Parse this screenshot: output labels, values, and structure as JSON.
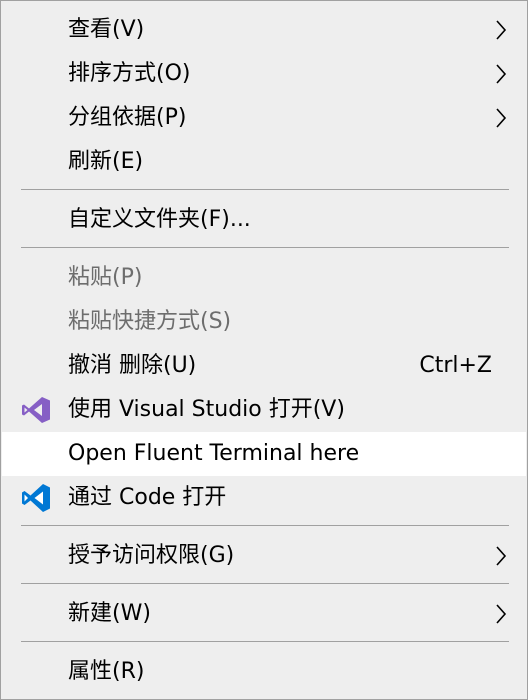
{
  "menu": {
    "items": [
      {
        "label": "查看(V)"
      },
      {
        "label": "排序方式(O)"
      },
      {
        "label": "分组依据(P)"
      },
      {
        "label": "刷新(E)"
      },
      {
        "label": "自定义文件夹(F)..."
      },
      {
        "label": "粘贴(P)"
      },
      {
        "label": "粘贴快捷方式(S)"
      },
      {
        "label": "撤消 删除(U)",
        "shortcut": "Ctrl+Z"
      },
      {
        "label": "使用 Visual Studio 打开(V)",
        "icon": "visual-studio-icon"
      },
      {
        "label": "Open Fluent Terminal here"
      },
      {
        "label": "通过 Code 打开",
        "icon": "vscode-icon"
      },
      {
        "label": "授予访问权限(G)"
      },
      {
        "label": "新建(W)"
      },
      {
        "label": "属性(R)"
      }
    ]
  },
  "colors": {
    "background": "#eeeeee",
    "hover_background": "#ffffff",
    "disabled_text": "#6d6d6d",
    "separator": "#a0a0a0",
    "visual_studio_purple": "#865fc5",
    "vscode_blue": "#0078d4"
  }
}
